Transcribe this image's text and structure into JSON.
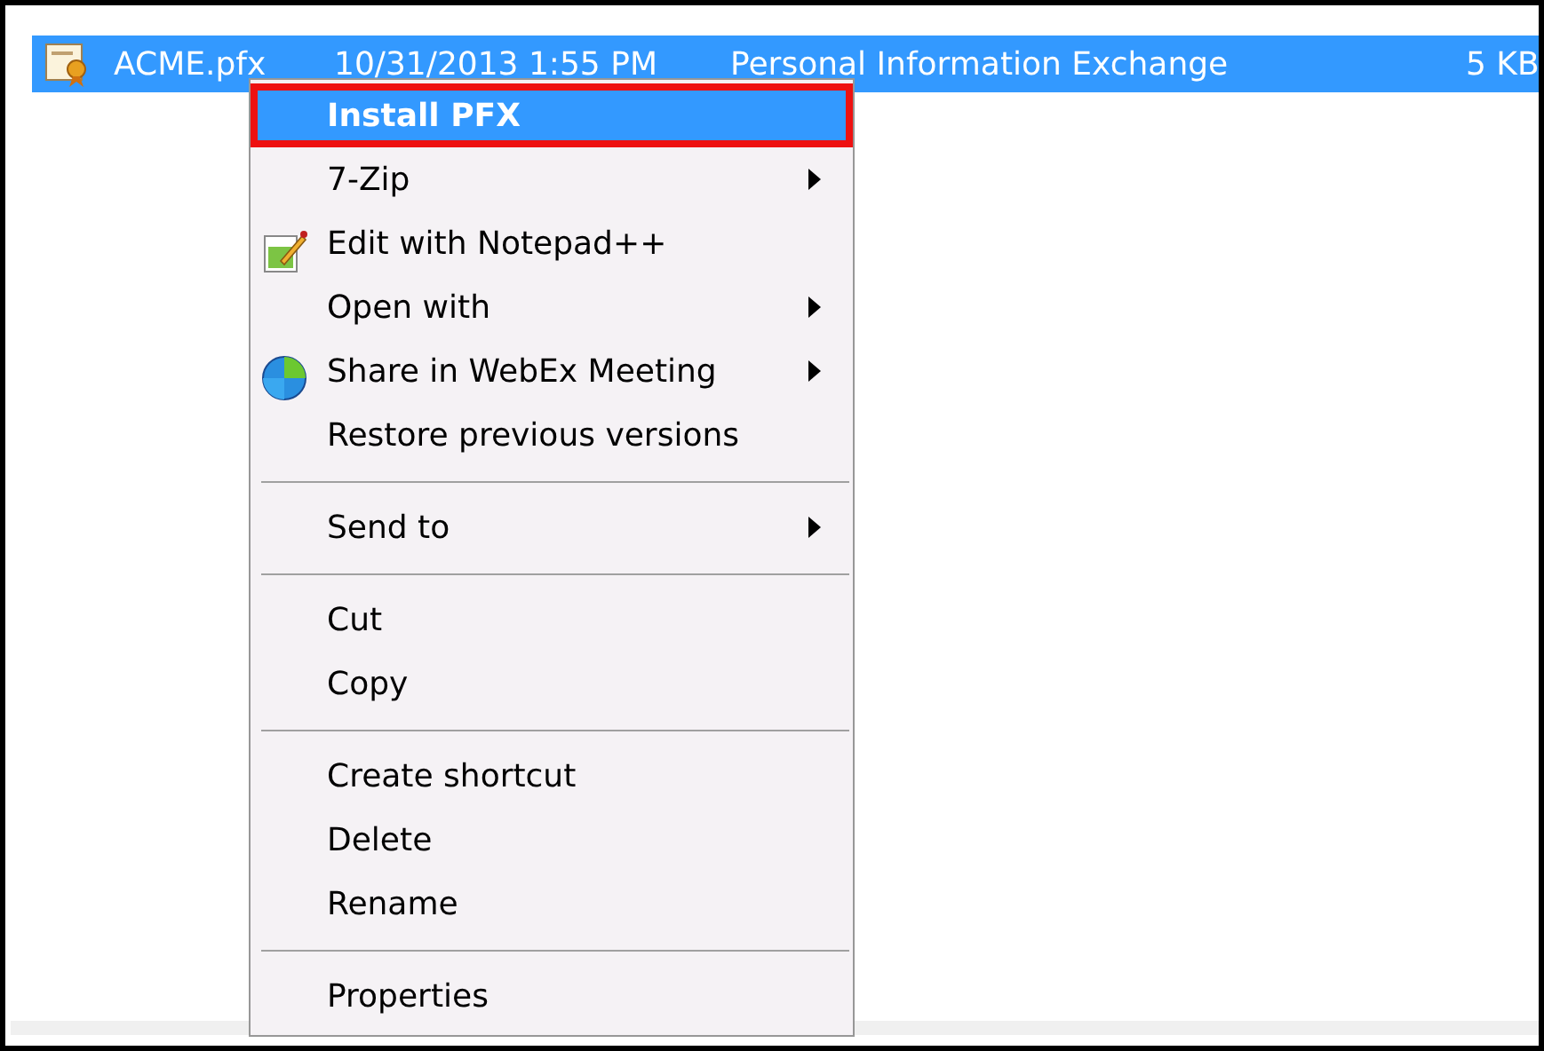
{
  "file_row": {
    "name": "ACME.pfx",
    "date_modified": "10/31/2013 1:55 PM",
    "type": "Personal Information Exchange",
    "size": "5 KB",
    "selected": true
  },
  "context_menu": {
    "items": [
      {
        "kind": "item",
        "label": "Install PFX",
        "selected": true,
        "default": true,
        "outlined": true,
        "submenu": false
      },
      {
        "kind": "item",
        "label": "7-Zip",
        "selected": false,
        "default": false,
        "outlined": false,
        "submenu": true
      },
      {
        "kind": "notepad",
        "label": "Edit with Notepad++",
        "selected": false,
        "default": false,
        "outlined": false,
        "submenu": false
      },
      {
        "kind": "item",
        "label": "Open with",
        "selected": false,
        "default": false,
        "outlined": false,
        "submenu": true
      },
      {
        "kind": "globe",
        "label": "Share in WebEx Meeting",
        "selected": false,
        "default": false,
        "outlined": false,
        "submenu": true
      },
      {
        "kind": "item",
        "label": "Restore previous versions",
        "selected": false,
        "default": false,
        "outlined": false,
        "submenu": false
      },
      {
        "kind": "separator"
      },
      {
        "kind": "item",
        "label": "Send to",
        "selected": false,
        "default": false,
        "outlined": false,
        "submenu": true
      },
      {
        "kind": "separator"
      },
      {
        "kind": "item",
        "label": "Cut",
        "selected": false,
        "default": false,
        "outlined": false,
        "submenu": false
      },
      {
        "kind": "item",
        "label": "Copy",
        "selected": false,
        "default": false,
        "outlined": false,
        "submenu": false
      },
      {
        "kind": "separator"
      },
      {
        "kind": "item",
        "label": "Create shortcut",
        "selected": false,
        "default": false,
        "outlined": false,
        "submenu": false
      },
      {
        "kind": "item",
        "label": "Delete",
        "selected": false,
        "default": false,
        "outlined": false,
        "submenu": false
      },
      {
        "kind": "item",
        "label": "Rename",
        "selected": false,
        "default": false,
        "outlined": false,
        "submenu": false
      },
      {
        "kind": "separator"
      },
      {
        "kind": "item",
        "label": "Properties",
        "selected": false,
        "default": false,
        "outlined": false,
        "submenu": false
      }
    ]
  }
}
